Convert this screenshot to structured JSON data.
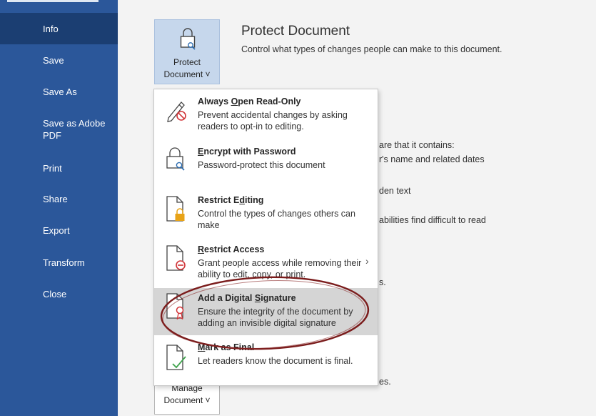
{
  "nav": {
    "items": [
      {
        "label": "Info",
        "active": true
      },
      {
        "label": "Save"
      },
      {
        "label": "Save As"
      },
      {
        "label": "Save as Adobe PDF"
      },
      {
        "label": "Print"
      },
      {
        "label": "Share"
      },
      {
        "label": "Export"
      },
      {
        "label": "Transform"
      },
      {
        "label": "Close"
      }
    ]
  },
  "protect": {
    "button_line1": "Protect",
    "button_line2": "Document ˅",
    "title": "Protect Document",
    "description": "Control what types of changes people can make to this document."
  },
  "background_text": {
    "line1": "are that it contains:",
    "line2": "r's name and related dates",
    "line3": "den text",
    "line4": "abilities find difficult to read",
    "line5": "s.",
    "line6": "es."
  },
  "manage": {
    "button_line1": "Manage",
    "button_line2": "Document ˅"
  },
  "menu": {
    "items": [
      {
        "title_pre": "Always ",
        "title_ul": "O",
        "title_post": "pen Read-Only",
        "desc": "Prevent accidental changes by asking readers to opt-in to editing.",
        "icon": "pencil-no-icon"
      },
      {
        "title_pre": "",
        "title_ul": "E",
        "title_post": "ncrypt with Password",
        "desc": "Password-protect this document",
        "icon": "lock-key-icon"
      },
      {
        "title_pre": "Restrict E",
        "title_ul": "d",
        "title_post": "iting",
        "desc": "Control the types of changes others can make",
        "icon": "document-lock-icon"
      },
      {
        "title_pre": "",
        "title_ul": "R",
        "title_post": "estrict Access",
        "desc": "Grant people access while removing their ability to edit, copy, or print.",
        "icon": "document-restrict-icon",
        "submenu_arrow": "›"
      },
      {
        "title_pre": "Add a Digital ",
        "title_ul": "S",
        "title_post": "ignature",
        "desc": "Ensure the integrity of the document by adding an invisible digital signature",
        "icon": "document-ribbon-icon",
        "highlighted": true
      },
      {
        "title_pre": "",
        "title_ul": "M",
        "title_post": "ark as Final",
        "desc": "Let readers know the document is final.",
        "icon": "document-check-icon"
      }
    ]
  },
  "colors": {
    "sidebar": "#2b579a",
    "sidebar_active": "#1b3e72",
    "protect_button": "#c6d7ec",
    "highlight": "#d5d5d5",
    "annotation": "#7b1c1c",
    "restrict_red": "#d13438",
    "lock_gold": "#e8a317",
    "check_green": "#3fa34d"
  }
}
